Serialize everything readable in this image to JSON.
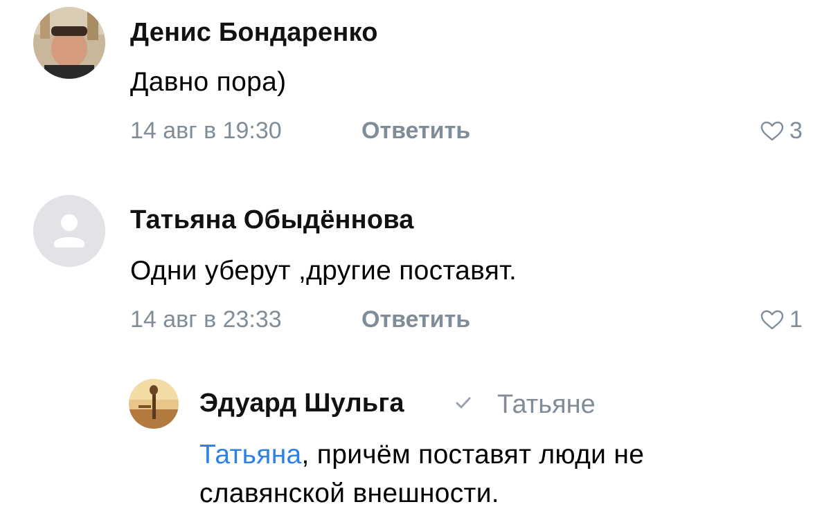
{
  "comments": [
    {
      "author": "Денис Бондаренко",
      "text": "Давно пора)",
      "date": "14 авг в 19:30",
      "reply_label": "Ответить",
      "likes": "3"
    },
    {
      "author": "Татьяна Обыдённова",
      "text": "Одни уберут ,другие поставят.",
      "date": "14 авг в 23:33",
      "reply_label": "Ответить",
      "likes": "1"
    }
  ],
  "reply": {
    "author": "Эдуард Шульга",
    "reply_to": "Татьяне",
    "mention": "Татьяна",
    "text_line1_rest": ", причём поставят люди не",
    "text_line2": "славянской внешности."
  },
  "colors": {
    "meta": "#818c99",
    "link": "#2a81e8",
    "placeholder_avatar": "#e1e3e6"
  },
  "icons": [
    "user-photo-avatar",
    "user-placeholder-icon",
    "heart-icon",
    "verified-check-icon"
  ]
}
